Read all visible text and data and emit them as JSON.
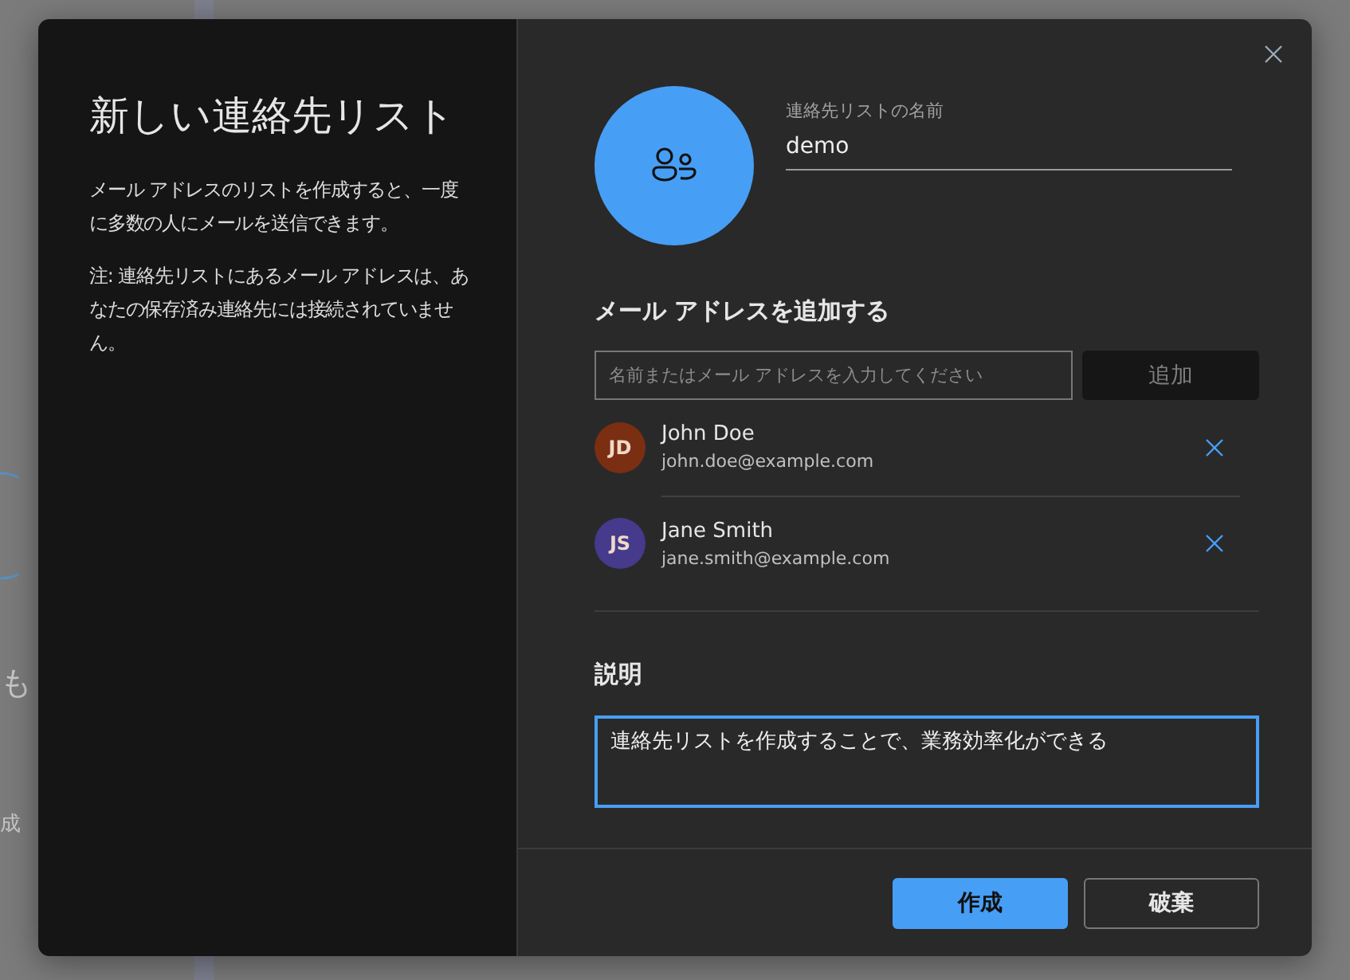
{
  "background": {
    "texts": [
      "も",
      "成"
    ]
  },
  "dialog": {
    "title": "新しい連絡先リスト",
    "paragraphs": [
      "メール アドレスのリストを作成すると、一度に多数の人にメールを送信できます。",
      "注: 連絡先リストにあるメール アドレスは、あなたの保存済み連絡先には接続されていません。"
    ],
    "name_field": {
      "label": "連絡先リストの名前",
      "value": "demo"
    },
    "add_section": {
      "heading": "メール アドレスを追加する",
      "placeholder": "名前またはメール アドレスを入力してください",
      "button": {
        "label": "追加",
        "disabled": true
      }
    },
    "contacts": [
      {
        "initials": "JD",
        "name": "John Doe",
        "email": "john.doe@example.com",
        "color": "#7a2e12"
      },
      {
        "initials": "JS",
        "name": "Jane Smith",
        "email": "jane.smith@example.com",
        "color": "#453a8c"
      }
    ],
    "description": {
      "heading": "説明",
      "value": "連絡先リストを作成することで、業務効率化ができる",
      "focused": true
    },
    "buttons": [
      {
        "label": "作成",
        "kind": "primary"
      },
      {
        "label": "破棄",
        "kind": "secondary"
      }
    ]
  }
}
